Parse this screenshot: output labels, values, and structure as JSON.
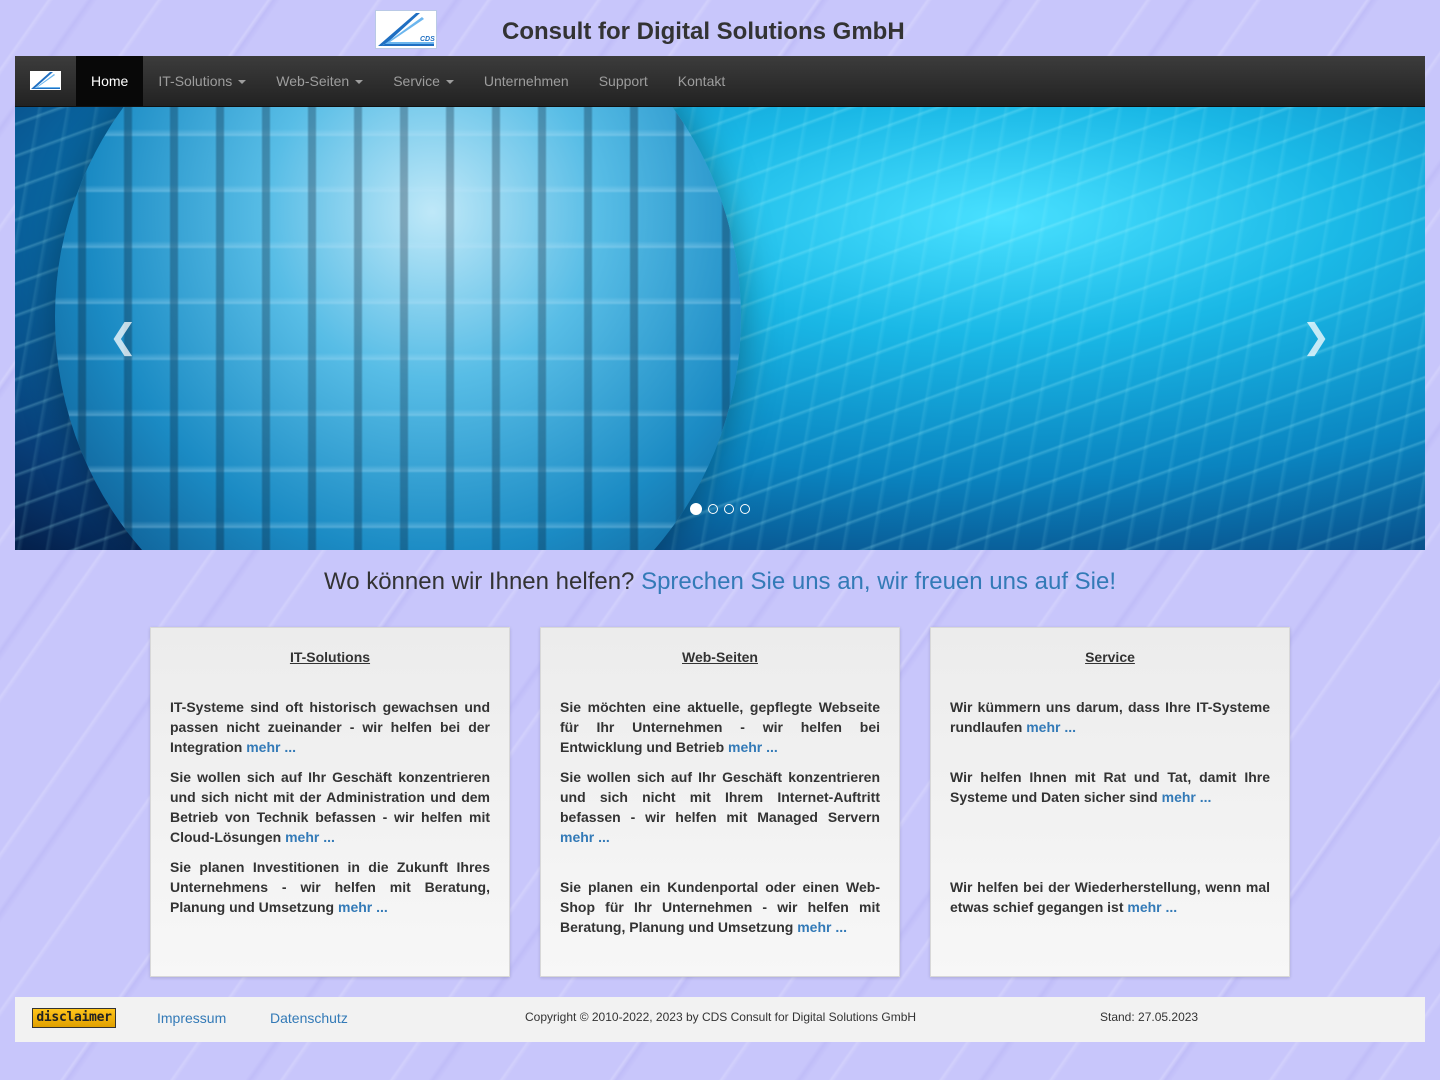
{
  "header": {
    "title": "Consult for Digital Solutions GmbH",
    "logo_text": "CDS"
  },
  "nav": {
    "items": [
      {
        "label": "Home",
        "active": true,
        "dropdown": false
      },
      {
        "label": "IT-Solutions",
        "active": false,
        "dropdown": true
      },
      {
        "label": "Web-Seiten",
        "active": false,
        "dropdown": true
      },
      {
        "label": "Service",
        "active": false,
        "dropdown": true
      },
      {
        "label": "Unternehmen",
        "active": false,
        "dropdown": false
      },
      {
        "label": "Support",
        "active": false,
        "dropdown": false
      },
      {
        "label": "Kontakt",
        "active": false,
        "dropdown": false
      }
    ]
  },
  "carousel": {
    "prev_icon": "chevron-left-icon",
    "next_icon": "chevron-right-icon",
    "prev_glyph": "❮",
    "next_glyph": "❯",
    "slide_count": 4,
    "active_slide": 1
  },
  "tagline": {
    "question": "Wo können wir Ihnen helfen?",
    "accent": "Sprechen Sie uns an, wir freuen uns auf Sie!"
  },
  "cards": [
    {
      "title": "IT-Solutions",
      "paragraphs": [
        {
          "text": "IT-Systeme sind oft historisch gewachsen und passen nicht zueinander - wir helfen bei der Integration",
          "more": "mehr ..."
        },
        {
          "text": "Sie wollen sich auf Ihr Geschäft konzentrieren und sich nicht mit der Administration und dem Betrieb von Technik befassen - wir helfen mit Cloud-Lösungen",
          "more": "mehr ..."
        },
        {
          "text": "Sie planen Investitionen in die Zukunft Ihres Unternehmens - wir helfen mit Beratung, Planung und Umsetzung",
          "more": "mehr ..."
        }
      ]
    },
    {
      "title": "Web-Seiten",
      "paragraphs": [
        {
          "text": "Sie möchten eine aktuelle, gepflegte Webseite für Ihr Unternehmen - wir helfen bei Entwicklung und Betrieb",
          "more": "mehr ..."
        },
        {
          "text": "Sie wollen sich auf Ihr Geschäft konzentrieren und sich nicht mit Ihrem Internet-Auftritt befassen - wir helfen mit Managed Servern",
          "more": "mehr ..."
        },
        {
          "text": "Sie planen ein Kundenportal oder einen Web-Shop für Ihr Unternehmen - wir helfen mit Beratung, Planung und Umsetzung",
          "more": "mehr ..."
        }
      ]
    },
    {
      "title": "Service",
      "paragraphs": [
        {
          "text": "Wir kümmern uns darum, dass Ihre IT-Systeme rundlaufen",
          "more": "mehr ..."
        },
        {
          "text": "Wir helfen Ihnen mit Rat und Tat, damit Ihre Systeme und Daten sicher sind",
          "more": "mehr ..."
        },
        {
          "text": "Wir helfen bei der Wiederherstellung, wenn mal etwas schief gegangen ist",
          "more": "mehr ..."
        }
      ]
    }
  ],
  "footer": {
    "disclaimer": "disclaimer",
    "impressum": "Impressum",
    "datenschutz": "Datenschutz",
    "copyright": "Copyright © 2010-2022, 2023 by CDS Consult for Digital Solutions GmbH",
    "stand": "Stand: 27.05.2023"
  },
  "colors": {
    "link": "#337ab7",
    "navbar": "#222222",
    "background": "#c8c6fb"
  }
}
